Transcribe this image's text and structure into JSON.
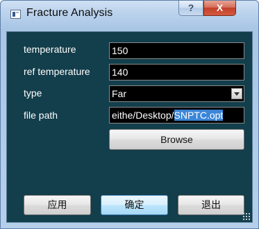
{
  "window": {
    "title": "Fracture Analysis",
    "help_label": "?",
    "close_label": "X"
  },
  "form": {
    "temperature": {
      "label": "temperature",
      "value": "150"
    },
    "ref_temperature": {
      "label": "ref temperature",
      "value": "140"
    },
    "type": {
      "label": "type",
      "value": "Far"
    },
    "file_path": {
      "label": "file path",
      "value_prefix": "eithe/Desktop/",
      "value_selected": "SNPTC.opt"
    },
    "browse_label": "Browse"
  },
  "buttons": {
    "apply": "应用",
    "ok": "确定",
    "exit": "退出"
  },
  "colors": {
    "client_background": "#133e4b",
    "field_background": "#000000",
    "selection": "#3b86d8",
    "close_button": "#c2402a"
  }
}
